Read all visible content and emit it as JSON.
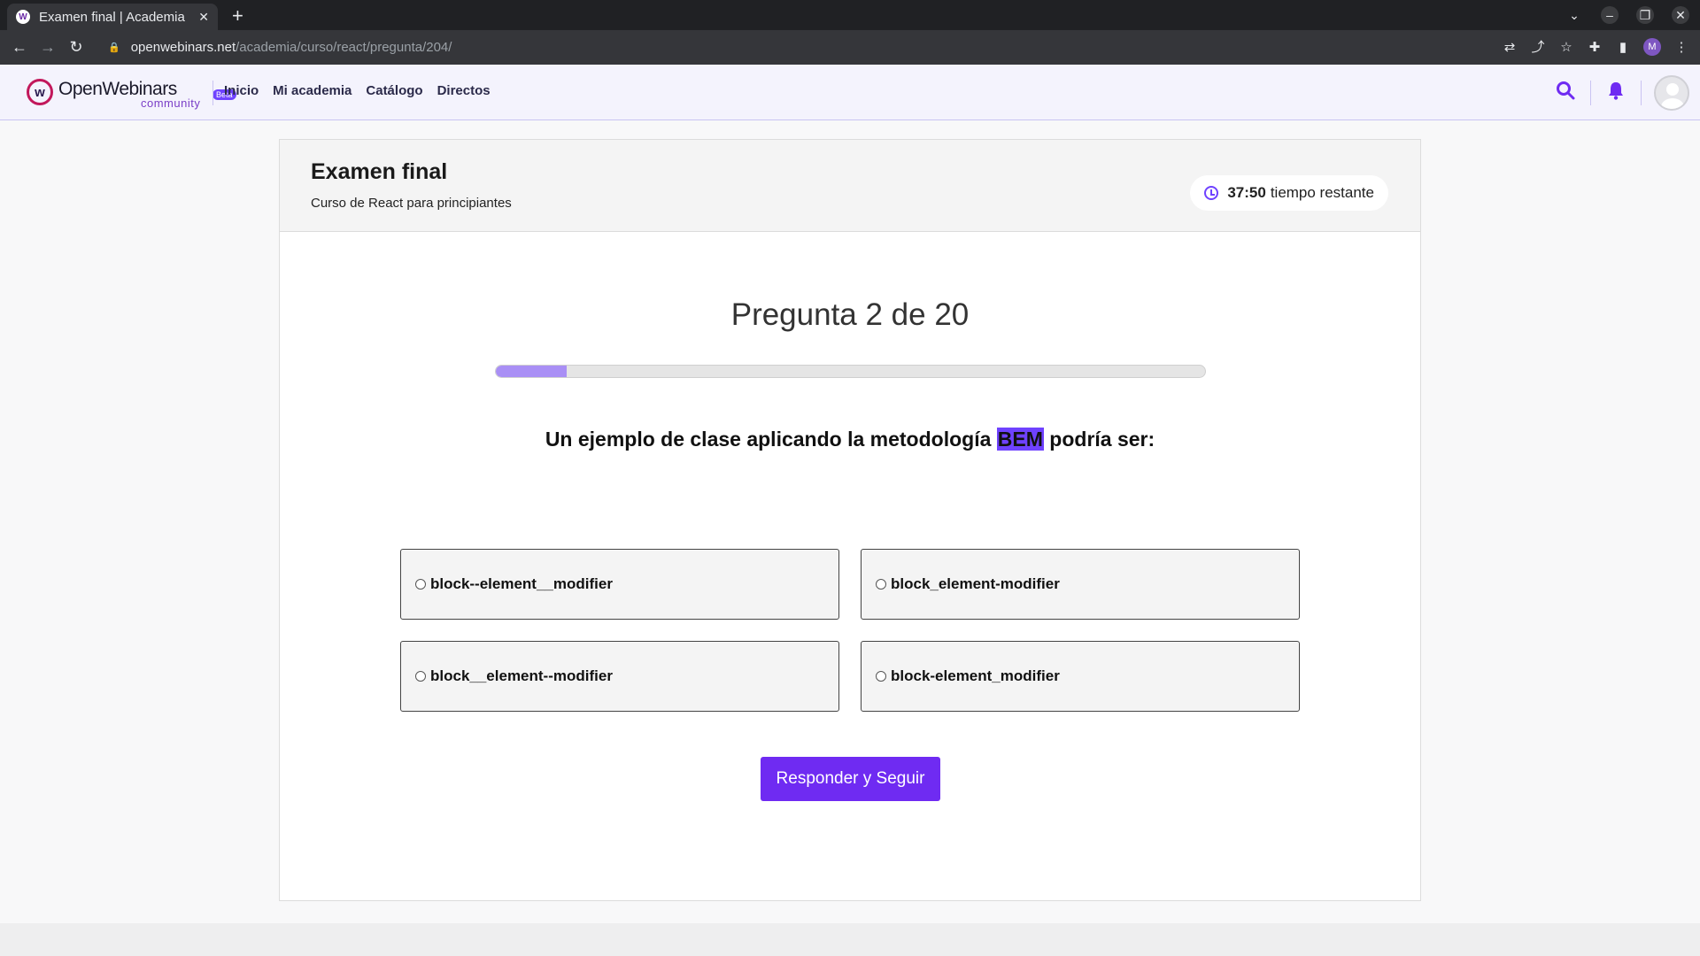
{
  "browser": {
    "tab_title": "Examen final | Academia",
    "tab_favicon": "W",
    "url_host": "openwebinars.net",
    "url_path": "/academia/curso/react/pregunta/204/",
    "profile_initial": "M"
  },
  "site": {
    "brand": "OpenWebinars",
    "brand_sub": "community",
    "badge": "Beta",
    "nav": [
      "Inicio",
      "Mi academia",
      "Catálogo",
      "Directos"
    ],
    "accent_color": "#6f2bf2"
  },
  "exam": {
    "title": "Examen final",
    "course": "Curso de React para principiantes",
    "timer_value": "37:50",
    "timer_label": "tiempo restante",
    "question_counter": "Pregunta 2 de 20",
    "progress_fraction": 0.1,
    "question_before": "Un ejemplo de clase aplicando la metodología",
    "question_highlight": "BEM",
    "question_after": "podría ser:",
    "options": [
      "block--element__modifier",
      "block_element-modifier",
      "block__element--modifier",
      "block-element_modifier"
    ],
    "submit_label": "Responder y Seguir"
  }
}
